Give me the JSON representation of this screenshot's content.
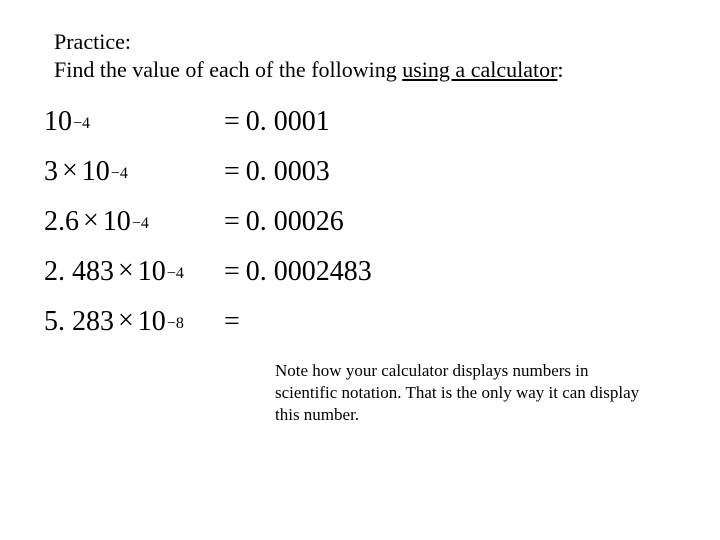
{
  "header": {
    "line1": "Practice:",
    "line2_a": "Find the value of each of the following ",
    "line2_b": "using a calculator",
    "line2_c": ":"
  },
  "rows": {
    "r0": {
      "pre": "",
      "base": "10",
      "exp": "−4",
      "eq": "=",
      "val": "0. 0001"
    },
    "r1": {
      "pre": "3",
      "base": "10",
      "exp": "−4",
      "eq": "=",
      "val": "0. 0003"
    },
    "r2": {
      "pre": "2.6",
      "base": "10",
      "exp": "−4",
      "eq": "=",
      "val": "0. 00026"
    },
    "r3": {
      "pre": "2. 483",
      "base": "10",
      "exp": "−4",
      "eq": "=",
      "val": "0. 0002483"
    },
    "r4": {
      "pre": "5. 283",
      "base": "10",
      "exp": "−8",
      "eq": "=",
      "val": ""
    }
  },
  "glyph": {
    "times": "×"
  },
  "note": "Note how your calculator displays numbers in scientific notation.  That is the only way it can display this number."
}
